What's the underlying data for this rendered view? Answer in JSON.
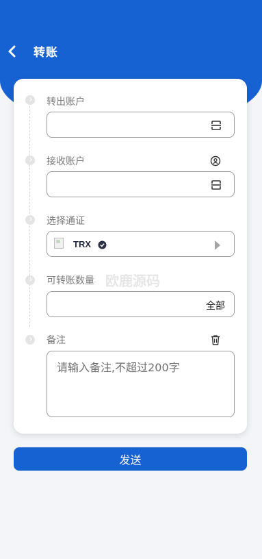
{
  "header": {
    "title": "转账",
    "back_icon": "chevron-left-icon"
  },
  "form": {
    "from_account": {
      "label": "转出账户",
      "value": "",
      "icon": "scan-icon"
    },
    "to_account": {
      "label": "接收账户",
      "value": "",
      "contact_icon": "contact-book-icon",
      "icon": "scan-icon"
    },
    "network": {
      "label": "选择通证",
      "selected_coin": "TRX",
      "verified_icon": "verified-check-icon",
      "arrow_icon": "caret-right-icon"
    },
    "amount": {
      "label": "可转账数量",
      "value": "",
      "all_label": "全部"
    },
    "remark": {
      "label": "备注",
      "placeholder": "请输入备注,不超过200字",
      "trash_icon": "trash-icon"
    }
  },
  "actions": {
    "send_label": "发送"
  },
  "watermark": {
    "text": "欧鹿源码"
  },
  "colors": {
    "primary": "#1762d3",
    "background": "#f3f5f9",
    "card": "#ffffff"
  }
}
